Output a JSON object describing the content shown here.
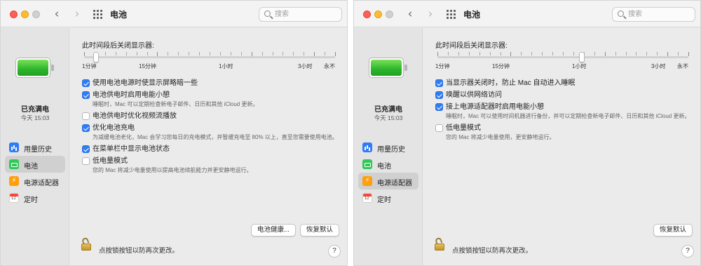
{
  "windows": [
    {
      "title": "电池",
      "search_placeholder": "搜索",
      "sidebar": {
        "status": "已充满电",
        "time": "今天 15:03",
        "items": [
          {
            "label": "用量历史",
            "icon": "usage-history-icon",
            "active": false
          },
          {
            "label": "电池",
            "icon": "battery-icon",
            "active": true
          },
          {
            "label": "电源适配器",
            "icon": "power-adapter-icon",
            "active": false
          },
          {
            "label": "定时",
            "icon": "schedule-icon",
            "active": false
          }
        ]
      },
      "display_off_label": "此时间段后关闭显示器:",
      "slider": {
        "labels": [
          "1分钟",
          "15分钟",
          "1小时",
          "3小时",
          "永不"
        ],
        "value": "2分钟"
      },
      "options": [
        {
          "label": "使用电池电源时使显示屏略暗一些",
          "checked": true,
          "desc": ""
        },
        {
          "label": "电池供电时启用电能小憩",
          "checked": true,
          "desc": "睡眠时，Mac 可以定期检查新电子邮件、日历和其他 iCloud 更新。"
        },
        {
          "label": "电池供电时优化视频流播放",
          "checked": false,
          "desc": ""
        },
        {
          "label": "优化电池充电",
          "checked": true,
          "desc": "为减缓电池老化，Mac 会学习您每日的充电模式，并暂缓充电至 80% 以上，直至您需要使用电池。"
        },
        {
          "label": "在菜单栏中显示电池状态",
          "checked": true,
          "desc": ""
        },
        {
          "label": "低电量模式",
          "checked": false,
          "desc": "您的 Mac 将减少电量使用以提高电池续航能力并更安静地运行。"
        }
      ],
      "buttons": {
        "health": "电池健康...",
        "restore": "恢复默认"
      },
      "lock_text": "点按锁按钮以防再次更改。",
      "help": "?"
    },
    {
      "title": "电池",
      "search_placeholder": "搜索",
      "sidebar": {
        "status": "已充满电",
        "time": "今天 15:03",
        "items": [
          {
            "label": "用量历史",
            "icon": "usage-history-icon",
            "active": false
          },
          {
            "label": "电池",
            "icon": "battery-icon",
            "active": false
          },
          {
            "label": "电源适配器",
            "icon": "power-adapter-icon",
            "active": true
          },
          {
            "label": "定时",
            "icon": "schedule-icon",
            "active": false
          }
        ]
      },
      "display_off_label": "此时间段后关闭显示器:",
      "slider": {
        "labels": [
          "1分钟",
          "15分钟",
          "1小时",
          "3小时",
          "永不"
        ],
        "value": "1小时"
      },
      "options": [
        {
          "label": "当显示器关闭时，防止 Mac 自动进入睡眠",
          "checked": true,
          "desc": ""
        },
        {
          "label": "唤醒以供网络访问",
          "checked": true,
          "desc": ""
        },
        {
          "label": "接上电源适配器时启用电能小憩",
          "checked": true,
          "desc": "睡眠时，Mac 可以使用时间机器进行备份，并可以定期检查新电子邮件、日历和其他 iCloud 更新。"
        },
        {
          "label": "低电量模式",
          "checked": false,
          "desc": "您的 Mac 将减少电量使用，更安静地运行。"
        }
      ],
      "buttons": {
        "restore": "恢复默认"
      },
      "lock_text": "点按锁按钮以防再次更改。",
      "help": "?"
    }
  ],
  "colors": {
    "accent": "#2f7cf6",
    "battery_green": "#2cb52c",
    "adapter_orange": "#ff9f0a"
  }
}
